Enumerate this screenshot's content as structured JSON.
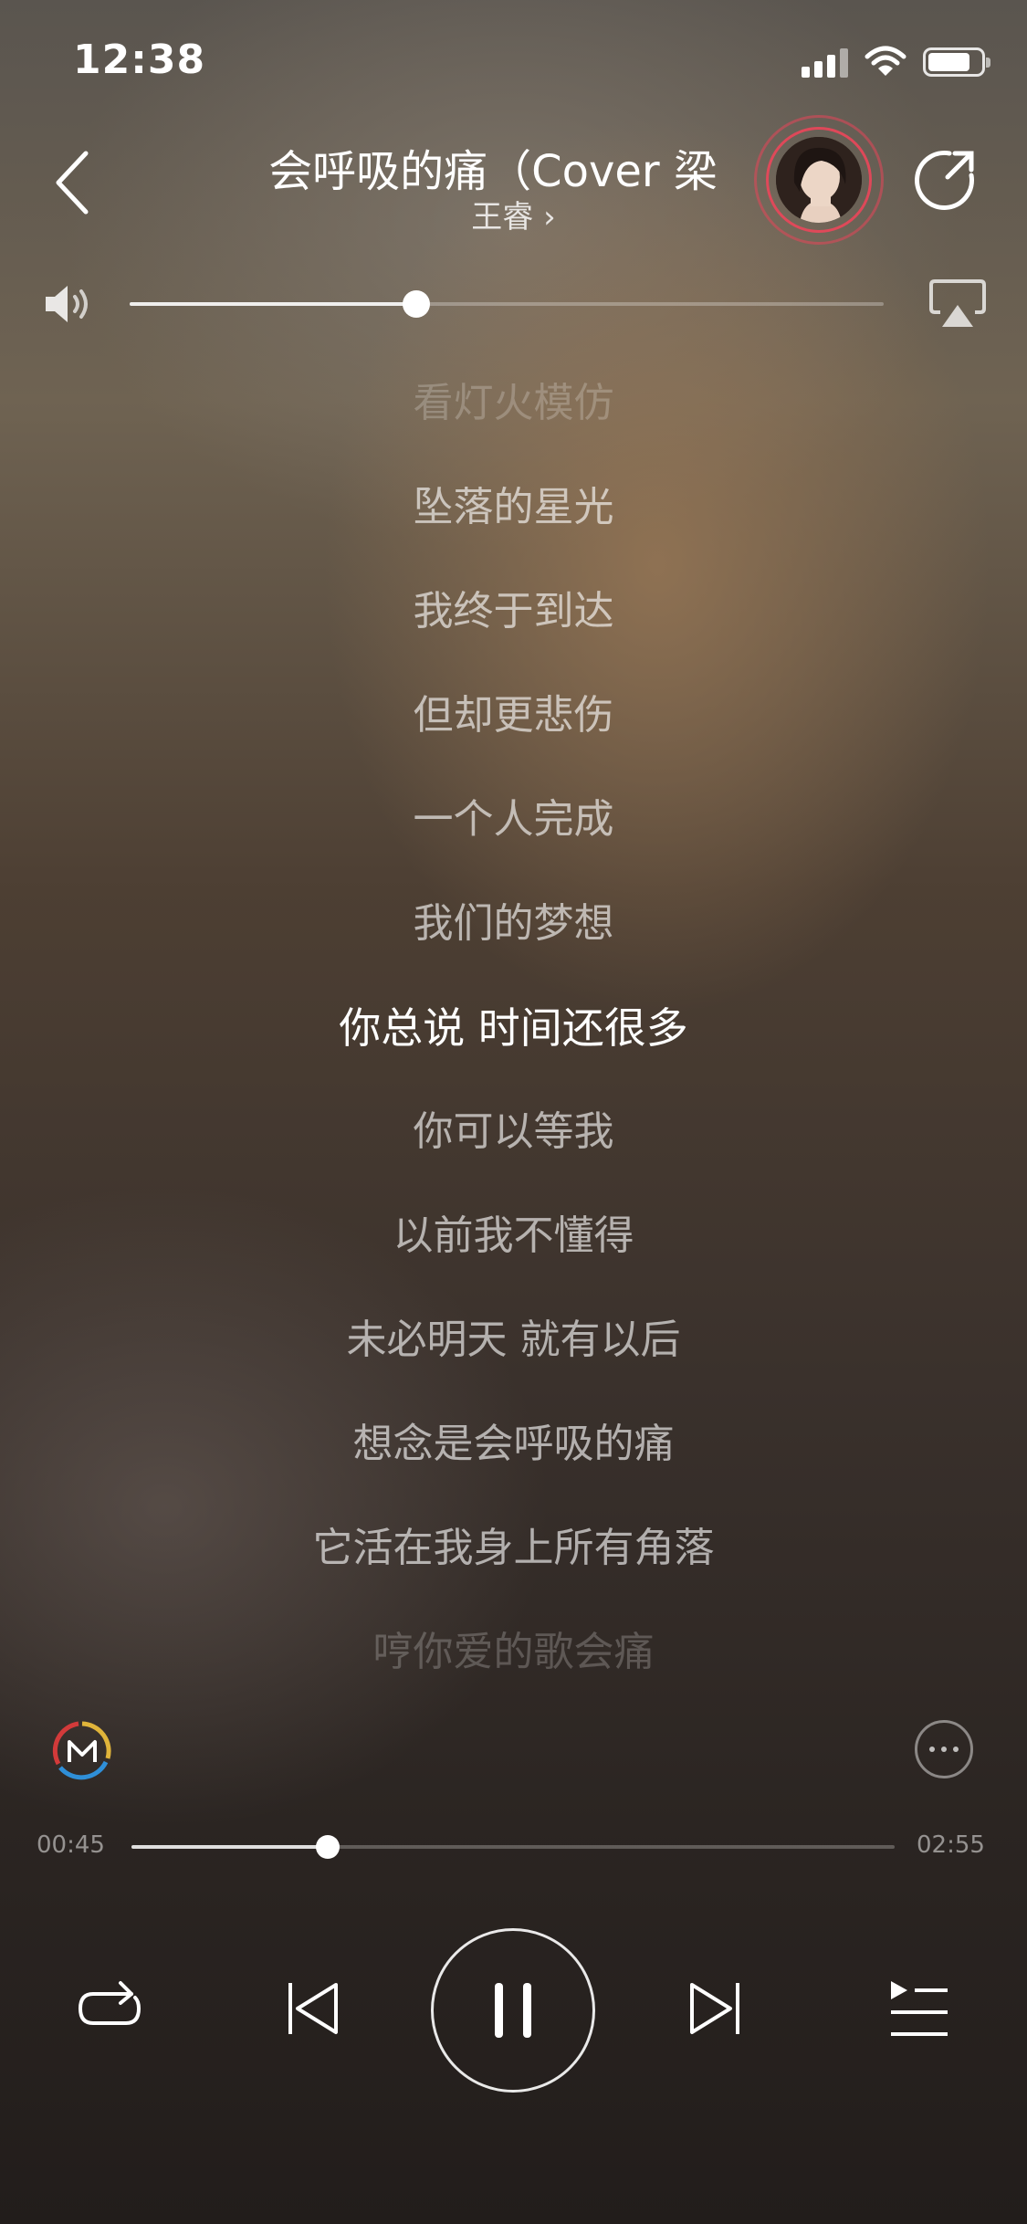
{
  "status_bar": {
    "time": "12:38"
  },
  "header": {
    "title": "会呼吸的痛（Cover 梁",
    "artist": "王睿 ›"
  },
  "volume": {
    "level": 0.38
  },
  "lyrics": [
    "看灯火模仿",
    "坠落的星光",
    "我终于到达",
    "但却更悲伤",
    "一个人完成",
    "我们的梦想",
    "你总说 时间还很多",
    "你可以等我",
    "以前我不懂得",
    "未必明天 就有以后",
    "想念是会呼吸的痛",
    "它活在我身上所有角落",
    "哼你爱的歌会痛"
  ],
  "current_lyric_index": 6,
  "playback": {
    "elapsed": "00:45",
    "duration": "02:55",
    "progress": 0.257
  },
  "icons": {
    "back": "chevron-left-icon",
    "share": "share-icon",
    "volume": "speaker-icon",
    "airplay": "airplay-icon",
    "logo": "m-logo-icon",
    "more": "more-icon",
    "repeat": "repeat-icon",
    "prev": "previous-icon",
    "pause": "pause-icon",
    "next": "next-icon",
    "playlist": "playlist-icon"
  }
}
